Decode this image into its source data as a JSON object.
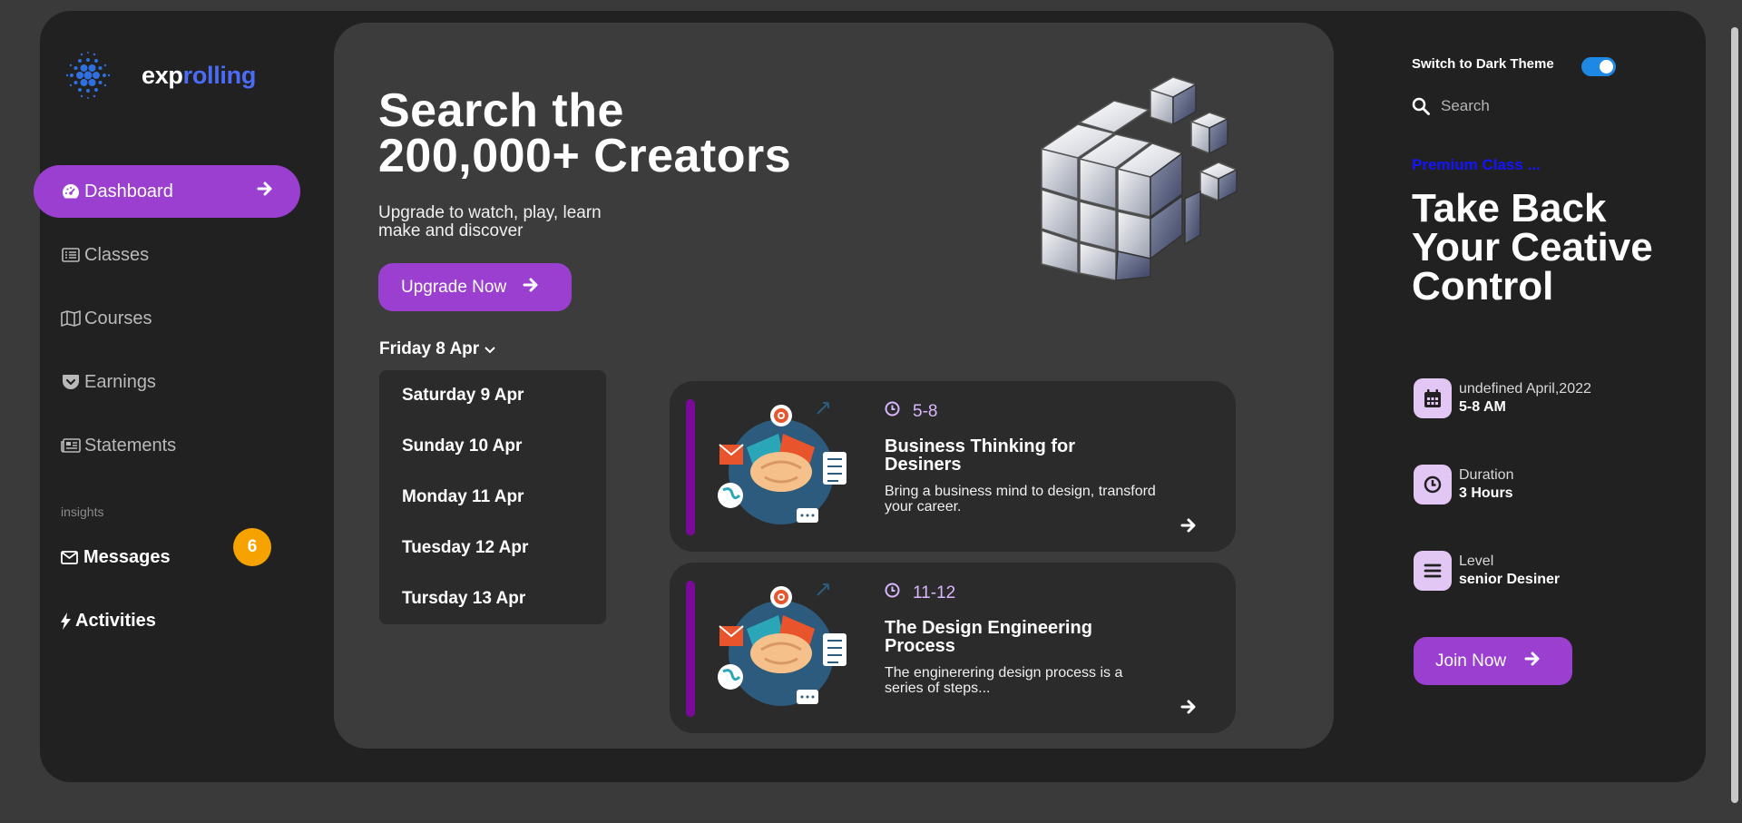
{
  "brand": {
    "name_a": "exp",
    "name_b": "rolling",
    "logo_icon": "dotted-sphere-icon",
    "accent": "#9b3fd1",
    "brand_blue": "#4a6cf7"
  },
  "sidebar": {
    "items": [
      {
        "label": "Dashboard",
        "icon": "dashboard-icon",
        "active": true
      },
      {
        "label": "Classes",
        "icon": "list-icon"
      },
      {
        "label": "Courses",
        "icon": "map-icon"
      },
      {
        "label": "Earnings",
        "icon": "pocket-icon"
      },
      {
        "label": "Statements",
        "icon": "newspaper-icon"
      }
    ],
    "insights_label": "insights",
    "messages_label": "Messages",
    "messages_count": "6",
    "activities_label": "Activities"
  },
  "hero": {
    "title_line1": "Search the",
    "title_line2": "200,000+ Creators",
    "subtitle": "Upgrade to watch, play, learn make and discover",
    "upgrade_label": "Upgrade Now"
  },
  "schedule": {
    "selected_date": "Friday 8 Apr",
    "options": [
      "Saturday 9 Apr",
      "Sunday 10 Apr",
      "Monday 11 Apr",
      "Tuesday 12 Apr",
      "Tursday 13 Apr"
    ]
  },
  "cards": [
    {
      "time": "5-8",
      "title": "Business Thinking for Desiners",
      "desc": "Bring a business mind to design, transford your career."
    },
    {
      "time": "11-12",
      "title": "The Design Engineering Process",
      "desc": "The enginerering design process is a series of steps..."
    }
  ],
  "right": {
    "theme_label": "Switch to Dark Theme",
    "theme_toggle_on": true,
    "search_placeholder": "Search",
    "premium_label": "Premium Class ...",
    "promo_title": "Take Back Your Ceative Control",
    "date_label": "undefined April,2022",
    "date_value": "5-8 AM",
    "duration_label": "Duration",
    "duration_value": "3 Hours",
    "level_label": "Level",
    "level_value": "senior Desiner",
    "join_label": "Join Now"
  }
}
